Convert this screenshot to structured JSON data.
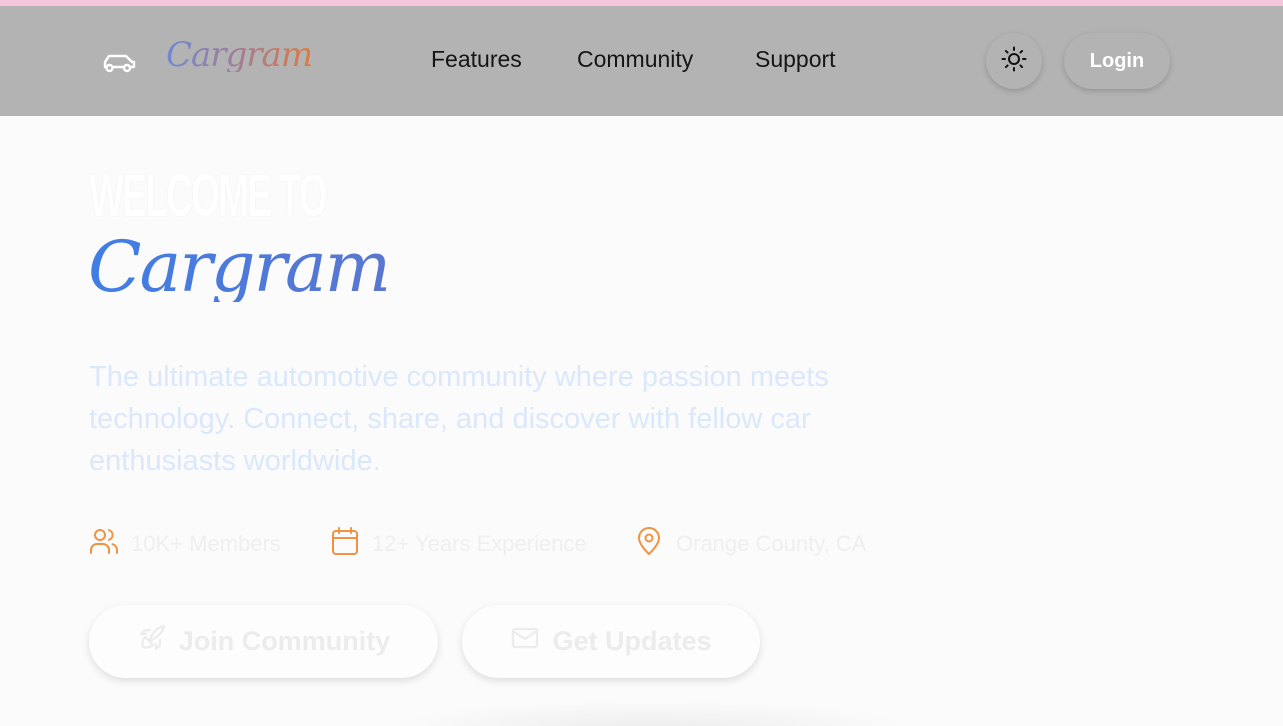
{
  "brand": {
    "name": "Cargram",
    "icon": "car-icon"
  },
  "nav": {
    "links": [
      "Features",
      "Community",
      "Support"
    ],
    "theme_toggle_icon": "sun-icon",
    "login_label": "Login"
  },
  "hero": {
    "eyebrow": "WELCOME TO",
    "title": "Cargram",
    "tagline": "The ultimate automotive community where passion meets technology. Connect, share, and discover with fellow car enthusiasts worldwide.",
    "stats": [
      {
        "icon": "users-icon",
        "text": "10K+ Members"
      },
      {
        "icon": "calendar-icon",
        "text": "12+ Years Experience"
      },
      {
        "icon": "map-pin-icon",
        "text": "Orange County, CA"
      }
    ],
    "buttons": [
      {
        "icon": "rocket-icon",
        "label": "Join Community"
      },
      {
        "icon": "mail-icon",
        "label": "Get Updates"
      }
    ]
  },
  "colors": {
    "top_strip": "#f6c6dc",
    "navbar_bg": "#b3b3b3",
    "accent_blue": "#3f7ee6",
    "accent_orange": "#f0923f",
    "page_bg": "#fbfbfb"
  }
}
